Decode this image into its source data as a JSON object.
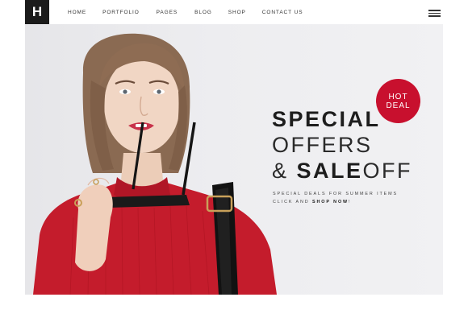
{
  "brand": {
    "logo_letter": "H"
  },
  "nav": {
    "items": [
      "HOME",
      "PORTFOLIO",
      "PAGES",
      "BLOG",
      "SHOP",
      "CONTACT US"
    ],
    "menu_icon": "hamburger-menu-icon"
  },
  "hero": {
    "badge_line1": "HOT",
    "badge_line2": "DEAL",
    "headline_line1": "SPECIAL",
    "headline_line2": "OFFERS",
    "headline_line3_amp": "& ",
    "headline_line3_bold": "SALE",
    "headline_line3_light": "OFF",
    "sub_line1": "SPECIAL DEALS FOR SUMMER ITEMS",
    "sub_line2_prefix": "CLICK AND ",
    "sub_line2_link": "SHOP NOW",
    "sub_line2_suffix": "!"
  },
  "colors": {
    "accent": "#c8102e",
    "dark": "#1b1b1b",
    "hero_bg": "#ececef"
  }
}
